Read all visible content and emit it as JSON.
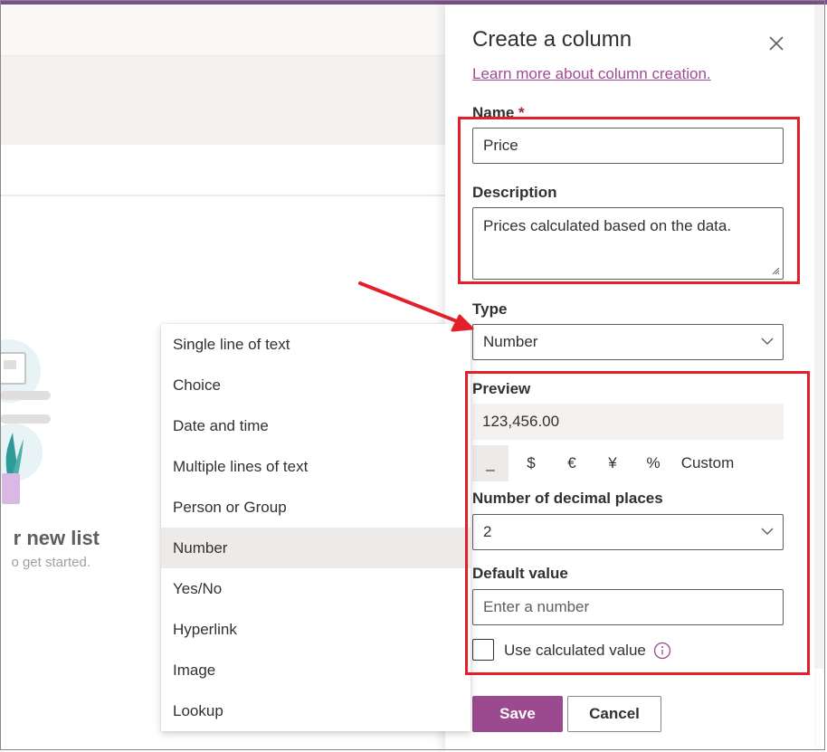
{
  "panel": {
    "title": "Create a column",
    "learn_link": "Learn more about column creation."
  },
  "name_field": {
    "label": "Name",
    "required_mark": "*",
    "value": "Price"
  },
  "description_field": {
    "label": "Description",
    "value": "Prices calculated based on the data."
  },
  "type_field": {
    "label": "Type",
    "value": "Number"
  },
  "type_options": [
    "Single line of text",
    "Choice",
    "Date and time",
    "Multiple lines of text",
    "Person or Group",
    "Number",
    "Yes/No",
    "Hyperlink",
    "Image",
    "Lookup"
  ],
  "selected_type": "Number",
  "preview": {
    "label": "Preview",
    "value": "123,456.00"
  },
  "format_options": [
    "_",
    "$",
    "€",
    "¥",
    "%",
    "Custom"
  ],
  "decimal_places": {
    "label": "Number of decimal places",
    "value": "2"
  },
  "default_value": {
    "label": "Default value",
    "placeholder": "Enter a number"
  },
  "calculated": {
    "label": "Use calculated value"
  },
  "buttons": {
    "save": "Save",
    "cancel": "Cancel"
  },
  "background": {
    "title_fragment": "r new list",
    "subtitle_fragment": "o get started."
  },
  "colors": {
    "accent": "#9c4a90",
    "link": "#a04a96",
    "annotation": "#e3202a",
    "topbar": "#7b4e8e"
  },
  "icons": [
    "close-icon",
    "chevron-down-icon",
    "info-icon",
    "resize-grip-icon"
  ]
}
